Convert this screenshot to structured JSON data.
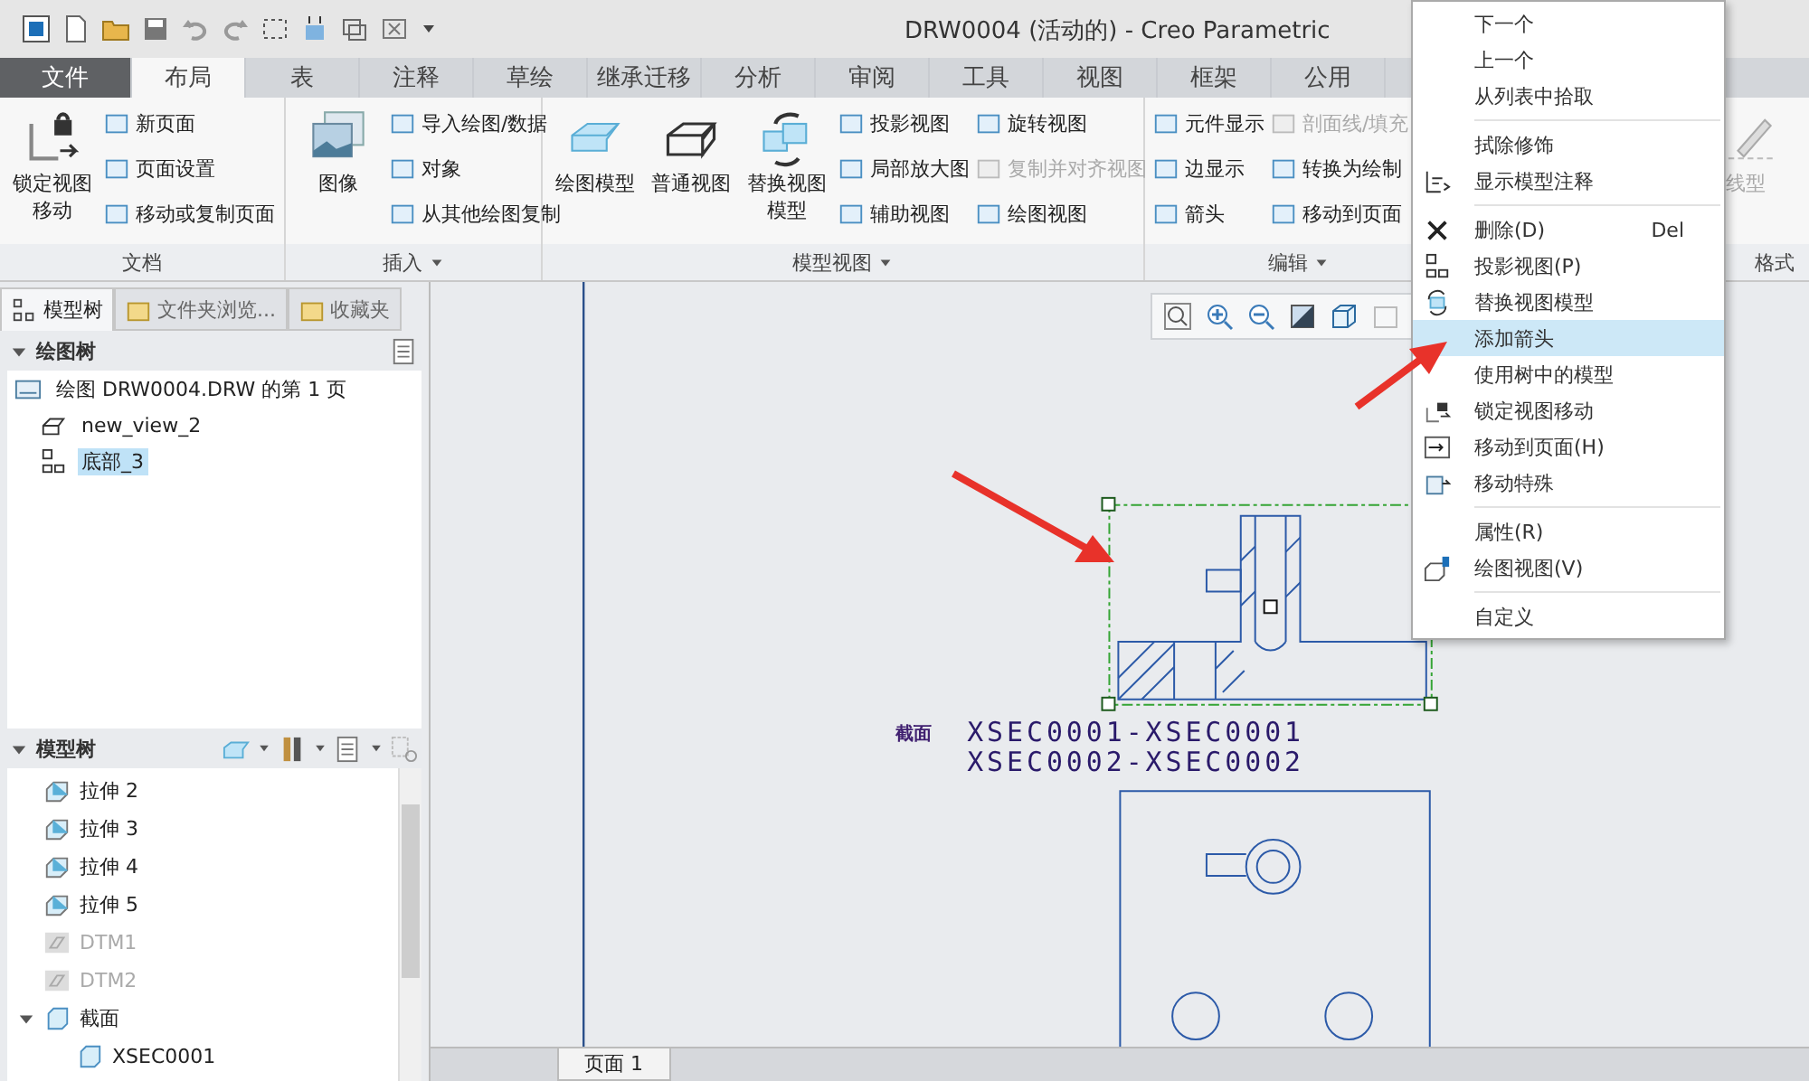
{
  "window": {
    "title": "DRW0004 (活动的) - Creo Parametric"
  },
  "ribbon_tabs": [
    {
      "label": "文件",
      "kind": "file",
      "selected": false
    },
    {
      "label": "布局",
      "kind": "tab",
      "selected": true
    },
    {
      "label": "表",
      "kind": "tab",
      "selected": false
    },
    {
      "label": "注释",
      "kind": "tab",
      "selected": false
    },
    {
      "label": "草绘",
      "kind": "tab",
      "selected": false
    },
    {
      "label": "继承迁移",
      "kind": "tab",
      "selected": false
    },
    {
      "label": "分析",
      "kind": "tab",
      "selected": false
    },
    {
      "label": "审阅",
      "kind": "tab",
      "selected": false
    },
    {
      "label": "工具",
      "kind": "tab",
      "selected": false
    },
    {
      "label": "视图",
      "kind": "tab",
      "selected": false
    },
    {
      "label": "框架",
      "kind": "tab",
      "selected": false
    },
    {
      "label": "公用",
      "kind": "tab",
      "selected": false
    }
  ],
  "ribbon_groups": [
    {
      "label": "文档",
      "dropdown": false,
      "columns": [
        [
          {
            "kind": "large",
            "label": "锁定视图移动",
            "disabled": false
          }
        ],
        [
          {
            "kind": "small",
            "label": "新页面",
            "disabled": false
          },
          {
            "kind": "small",
            "label": "页面设置",
            "disabled": false
          },
          {
            "kind": "small",
            "label": "移动或复制页面",
            "disabled": false
          }
        ]
      ]
    },
    {
      "label": "插入",
      "dropdown": true,
      "columns": [
        [
          {
            "kind": "large",
            "label": "图像",
            "disabled": false
          }
        ],
        [
          {
            "kind": "small",
            "label": "导入绘图/数据",
            "disabled": false
          },
          {
            "kind": "small",
            "label": "对象",
            "disabled": false
          },
          {
            "kind": "small",
            "label": "从其他绘图复制",
            "disabled": false
          }
        ]
      ]
    },
    {
      "label": "模型视图",
      "dropdown": true,
      "columns": [
        [
          {
            "kind": "large",
            "label": "绘图模型",
            "disabled": false
          }
        ],
        [
          {
            "kind": "large",
            "label": "普通视图",
            "disabled": false
          }
        ],
        [
          {
            "kind": "large",
            "label": "替换视图模型",
            "disabled": false
          }
        ],
        [
          {
            "kind": "small",
            "label": "投影视图",
            "disabled": false
          },
          {
            "kind": "small",
            "label": "局部放大图",
            "disabled": false
          },
          {
            "kind": "small",
            "label": "辅助视图",
            "disabled": false
          }
        ],
        [
          {
            "kind": "small",
            "label": "旋转视图",
            "disabled": false
          },
          {
            "kind": "small",
            "label": "复制并对齐视图",
            "disabled": true
          },
          {
            "kind": "small",
            "label": "绘图视图",
            "disabled": false
          }
        ]
      ]
    },
    {
      "label": "编辑",
      "dropdown": true,
      "columns": [
        [
          {
            "kind": "small",
            "label": "元件显示",
            "disabled": false
          },
          {
            "kind": "small",
            "label": "边显示",
            "disabled": false
          },
          {
            "kind": "small",
            "label": "箭头",
            "disabled": false
          }
        ],
        [
          {
            "kind": "small",
            "label": "剖面线/填充",
            "disabled": true
          },
          {
            "kind": "small",
            "label": "转换为绘制",
            "disabled": false
          },
          {
            "kind": "small",
            "label": "移动到页面",
            "disabled": false
          }
        ]
      ]
    },
    {
      "label": "格式",
      "dropdown": false,
      "columns": [
        [
          {
            "kind": "large",
            "label": "线型",
            "disabled": true
          }
        ]
      ]
    }
  ],
  "panel_tabs": [
    {
      "label": "模型树",
      "selected": true
    },
    {
      "label": "文件夹浏览...",
      "selected": false
    },
    {
      "label": "收藏夹",
      "selected": false
    }
  ],
  "drawing_tree": {
    "title": "绘图树",
    "items": [
      {
        "label": "绘图 DRW0004.DRW 的第 1 页",
        "selected": false,
        "children": [
          {
            "label": "new_view_2",
            "selected": false
          },
          {
            "label": "底部_3",
            "selected": true
          }
        ]
      }
    ]
  },
  "model_tree": {
    "title": "模型树",
    "items": [
      {
        "label": "拉伸 2",
        "kind": "extrude",
        "disabled": false
      },
      {
        "label": "拉伸 3",
        "kind": "extrude",
        "disabled": false
      },
      {
        "label": "拉伸 4",
        "kind": "extrude",
        "disabled": false
      },
      {
        "label": "拉伸 5",
        "kind": "extrude",
        "disabled": false
      },
      {
        "label": "DTM1",
        "kind": "datum",
        "disabled": true
      },
      {
        "label": "DTM2",
        "kind": "datum",
        "disabled": true
      },
      {
        "label": "截面",
        "kind": "section",
        "disabled": false,
        "expanded": true,
        "children": [
          {
            "label": "XSEC0001",
            "disabled": false
          }
        ]
      }
    ]
  },
  "canvas": {
    "section_label": "截面",
    "section_names": [
      "XSEC0001-XSEC0001",
      "XSEC0002-XSEC0002"
    ],
    "page_tab": "页面 1"
  },
  "context_menu": [
    {
      "kind": "item",
      "label": "下一个",
      "selected": false
    },
    {
      "kind": "item",
      "label": "上一个",
      "selected": false
    },
    {
      "kind": "item",
      "label": "从列表中拾取",
      "selected": false
    },
    {
      "kind": "separator"
    },
    {
      "kind": "item",
      "label": "拭除修饰",
      "selected": false
    },
    {
      "kind": "item",
      "label": "显示模型注释",
      "selected": false
    },
    {
      "kind": "separator"
    },
    {
      "kind": "item",
      "label": "删除(D)",
      "shortcut": "Del",
      "selected": false
    },
    {
      "kind": "item",
      "label": "投影视图(P)",
      "selected": false
    },
    {
      "kind": "item",
      "label": "替换视图模型",
      "selected": false
    },
    {
      "kind": "item",
      "label": "添加箭头",
      "selected": true
    },
    {
      "kind": "item",
      "label": "使用树中的模型",
      "selected": false
    },
    {
      "kind": "item",
      "label": "锁定视图移动",
      "selected": false
    },
    {
      "kind": "item",
      "label": "移动到页面(H)",
      "selected": false
    },
    {
      "kind": "item",
      "label": "移动特殊",
      "selected": false
    },
    {
      "kind": "separator"
    },
    {
      "kind": "item",
      "label": "属性(R)",
      "selected": false
    },
    {
      "kind": "item",
      "label": "绘图视图(V)",
      "selected": false
    },
    {
      "kind": "separator"
    },
    {
      "kind": "item",
      "label": "自定义",
      "selected": false
    }
  ]
}
